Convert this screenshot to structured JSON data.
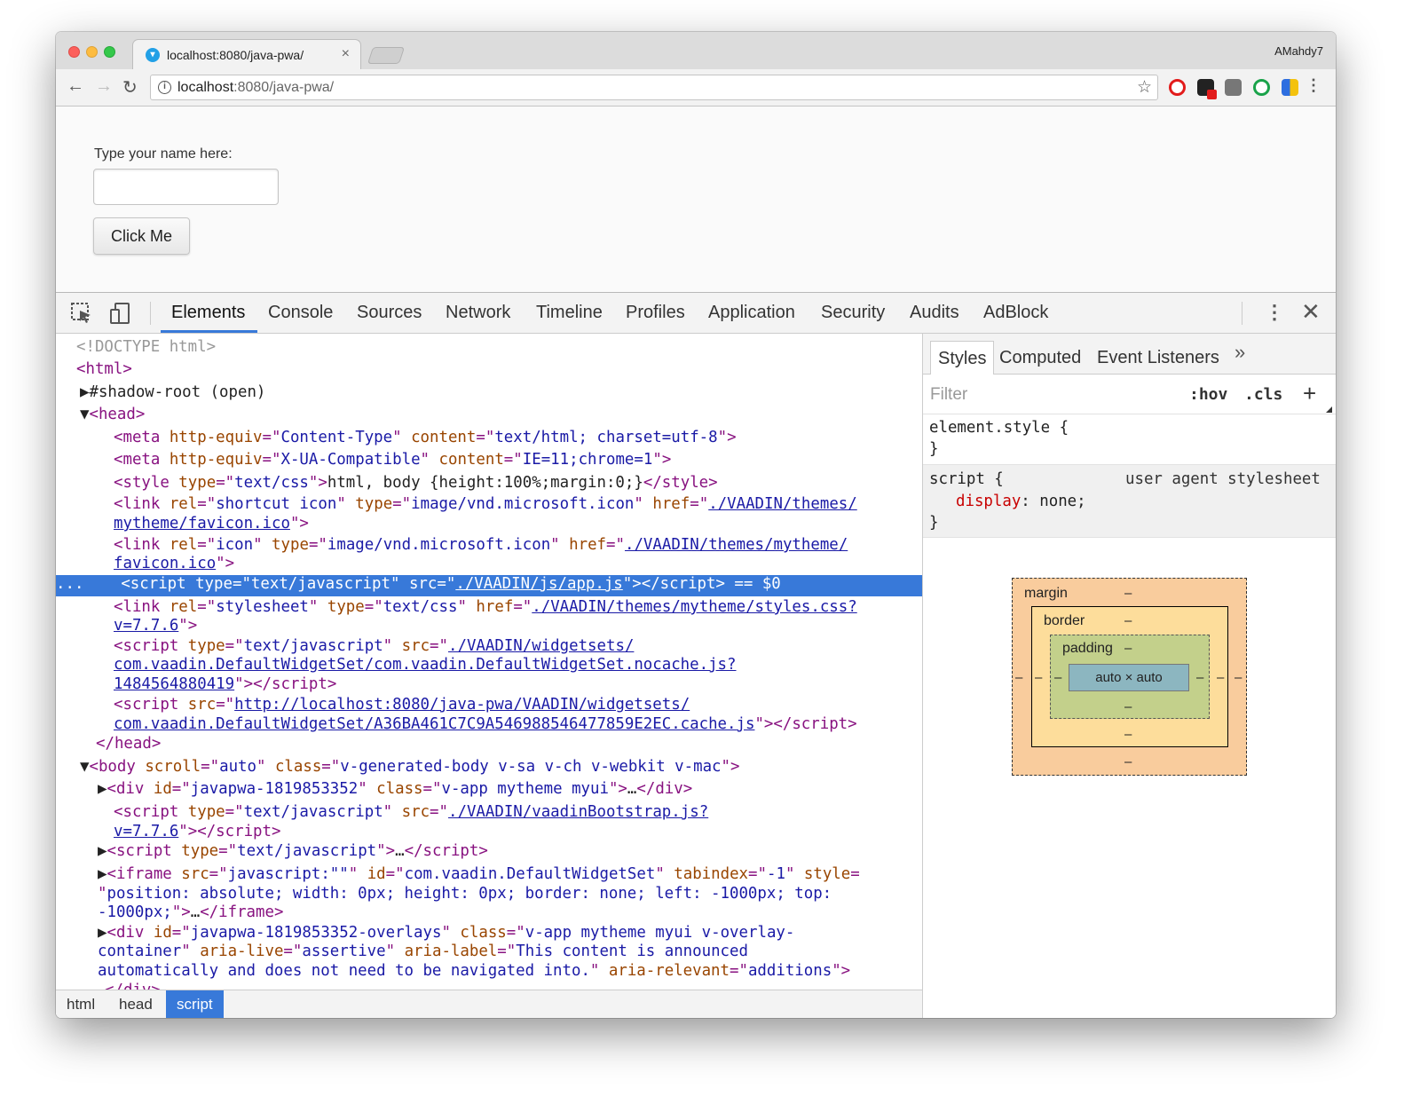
{
  "browser": {
    "tab_title": "localhost:8080/java-pwa/",
    "tab_close": "×",
    "profile_name": "AMahdy7",
    "url_host": "localhost",
    "url_path": ":8080/java-pwa/",
    "back": "←",
    "forward": "→",
    "reload": "↻",
    "star": "☆",
    "menu": "⋮"
  },
  "page": {
    "name_label": "Type your name here:",
    "name_value": "",
    "button_label": "Click Me"
  },
  "devtools": {
    "tabs": [
      "Elements",
      "Console",
      "Sources",
      "Network",
      "Timeline",
      "Profiles",
      "Application",
      "Security",
      "Audits",
      "AdBlock"
    ],
    "active_tab": "Elements",
    "close": "✕",
    "kebab": "⋮",
    "breadcrumbs": [
      "html",
      "head",
      "script"
    ],
    "active_breadcrumb": "script",
    "selected_marker": "...",
    "selected_suffix": "== $0"
  },
  "styles": {
    "tabs": [
      "Styles",
      "Computed",
      "Event Listeners"
    ],
    "more": "»",
    "filter_placeholder": "Filter",
    "hov": ":hov",
    "cls": ".cls",
    "add": "+",
    "rule1_selector": "element.style {",
    "rule1_close": "}",
    "rule2_selector": "script {",
    "rule2_source": "user agent stylesheet",
    "rule2_prop": "display",
    "rule2_value": " none;",
    "rule2_close": "}"
  },
  "box_model": {
    "margin_label": "margin",
    "border_label": "border",
    "padding_label": "padding",
    "content": "auto × auto",
    "dash": "–"
  },
  "colors": {
    "accent": "#3879d9",
    "tag": "#881280",
    "attr_name": "#994500",
    "attr_value": "#1a1aa6"
  }
}
